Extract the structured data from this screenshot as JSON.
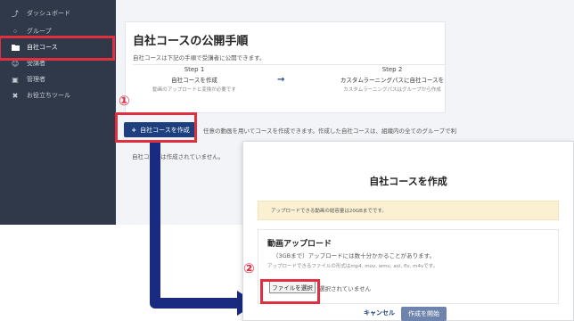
{
  "sidebar": {
    "items": [
      {
        "label": "ダッシュボード",
        "icon": "chart-icon"
      },
      {
        "label": "グループ",
        "icon": "group-icon"
      },
      {
        "label": "自社コース",
        "icon": "folder-icon",
        "active": true
      },
      {
        "label": "受講者",
        "icon": "users-icon"
      },
      {
        "label": "管理者",
        "icon": "admin-icon"
      },
      {
        "label": "お役立ちツール",
        "icon": "tools-icon"
      }
    ]
  },
  "main": {
    "card": {
      "title": "自社コースの公開手順",
      "subtitle": "自社コースは下記の手順で受講者に公開できます。",
      "steps": [
        {
          "num": "Step 1",
          "title": "自社コースを作成",
          "desc": "動画のアップロードと変換が必要です"
        },
        {
          "num": "Step 2",
          "title": "カスタムラーニングパスに自社コースを",
          "desc": "カスタムラーニングパスはグループから作成"
        }
      ]
    },
    "create_button": "自社コースを作成",
    "description": "任意の動画を用いてコースを作成できます。作成した自社コースは、組織内の全てのグループで利",
    "empty_message": "自社コースは作成されていません。"
  },
  "annotations": {
    "marker_1": "①",
    "marker_2": "②"
  },
  "modal": {
    "title": "自社コースを作成",
    "info": "アップロードできる動画の総容量は20GBまでです。",
    "upload": {
      "title": "動画アップロード",
      "note": "（3GBまで）アップロードには数十分かかることがあります。",
      "formats": "アップロードできるファイルの形式はmp4, mov, wmv, avi, flv, m4vです。",
      "file_button": "ファイルを選択",
      "file_status": "選択されていません"
    },
    "cancel": "キャンセル",
    "start": "作成を開始"
  },
  "colors": {
    "sidebar_bg": "#2f3949",
    "primary": "#1e3f7d",
    "highlight": "#e03040",
    "info_bg": "#fbf1d2"
  }
}
